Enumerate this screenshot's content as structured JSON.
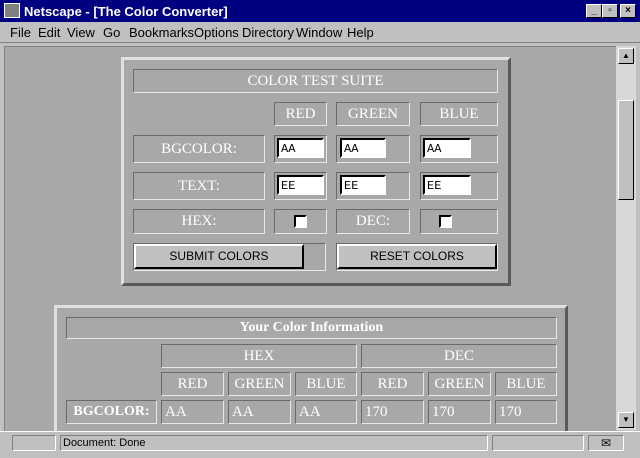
{
  "window": {
    "title": "Netscape - [The Color Converter]"
  },
  "menu": [
    "File",
    "Edit",
    "View",
    "Go",
    "Bookmarks",
    "Options",
    "Directory",
    "Window",
    "Help"
  ],
  "form": {
    "title": "COLOR TEST SUITE",
    "col_red": "RED",
    "col_green": "GREEN",
    "col_blue": "BLUE",
    "bgcolor_label": "BGCOLOR:",
    "text_label": "TEXT:",
    "hex_label": "HEX:",
    "dec_label": "DEC:",
    "bg_red": "AA",
    "bg_green": "AA",
    "bg_blue": "AA",
    "text_red": "EE",
    "text_green": "EE",
    "text_blue": "EE",
    "hex_checked": false,
    "dec_checked": false,
    "submit_label": "SUBMIT COLORS",
    "reset_label": "RESET COLORS"
  },
  "info": {
    "title": "Your Color Information",
    "hex_header": "HEX",
    "dec_header": "DEC",
    "col_red": "RED",
    "col_green": "GREEN",
    "col_blue": "BLUE",
    "bgcolor_label": "BGCOLOR:",
    "hex_red": "AA",
    "hex_green": "AA",
    "hex_blue": "AA",
    "dec_red": "170",
    "dec_green": "170",
    "dec_blue": "170"
  },
  "status": {
    "text": "Document: Done"
  },
  "icons": [
    "netscape-logo-icon",
    "minimize-icon",
    "maximize-icon",
    "close-icon",
    "scroll-up-icon",
    "scroll-down-icon",
    "security-key-icon",
    "mail-icon"
  ],
  "colors": {
    "titlebar": "#000080",
    "page_bg": "#a8a8a8",
    "chrome": "#c0c0c0"
  }
}
